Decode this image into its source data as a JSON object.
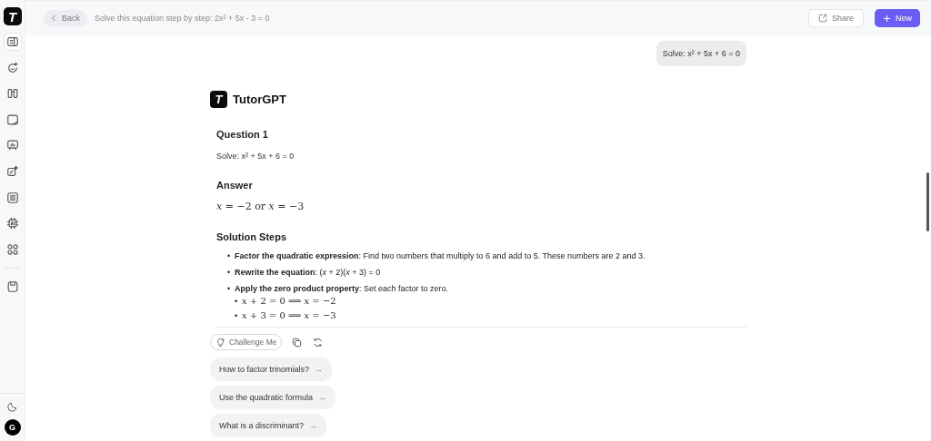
{
  "sidebar": {
    "logo": "T",
    "items": [
      {
        "selected": true
      },
      {
        "selected": false
      },
      {
        "selected": false
      },
      {
        "selected": false
      },
      {
        "selected": false
      },
      {
        "selected": false
      },
      {
        "selected": false
      },
      {
        "selected": false
      },
      {
        "selected": false
      },
      {
        "selected": false
      }
    ],
    "avatar": "G"
  },
  "topbar": {
    "back": "Back",
    "title": "Solve this equation step by step: 2x² + 5x - 3 = 0",
    "share": "Share",
    "new": "New"
  },
  "user_message": "Solve: x² + 5x + 6 = 0",
  "assistant": {
    "logo": "T",
    "name": "TutorGPT"
  },
  "sections": [
    {
      "heading": "Question 1",
      "kind": "text",
      "text": "Solve: x² + 5x + 6 = 0"
    },
    {
      "heading": "Answer",
      "kind": "math",
      "text": "*x* = −2 or *x* = −3"
    },
    {
      "heading": "Solution Steps",
      "kind": "list",
      "items": [
        {
          "bullet": "•",
          "text": "**Factor the quadratic expression**: Find two numbers that multiply to 6 and add to 5. These numbers are 2 and 3."
        },
        {
          "bullet": "•",
          "text": "**Rewrite the equation**: (*x* + 2)(*x* + 3) = 0"
        },
        {
          "bullet": "•",
          "text": "**Apply the zero product property**: Set each factor to zero.",
          "children": [
            {
              "bullet": "•",
              "text": "*x* + 2 = 0 ⟹ *x* = −2"
            },
            {
              "bullet": "•",
              "text": "*x* + 3 = 0 ⟹ *x* = −3"
            }
          ]
        }
      ]
    }
  ],
  "actions": {
    "challenge": "Challenge Me"
  },
  "suggestions": [
    {
      "text": "How to factor trinomials?",
      "arrow": "→"
    },
    {
      "text": "Use the quadratic formula",
      "arrow": "→"
    },
    {
      "text": "What is a discriminant?",
      "arrow": "→"
    }
  ]
}
